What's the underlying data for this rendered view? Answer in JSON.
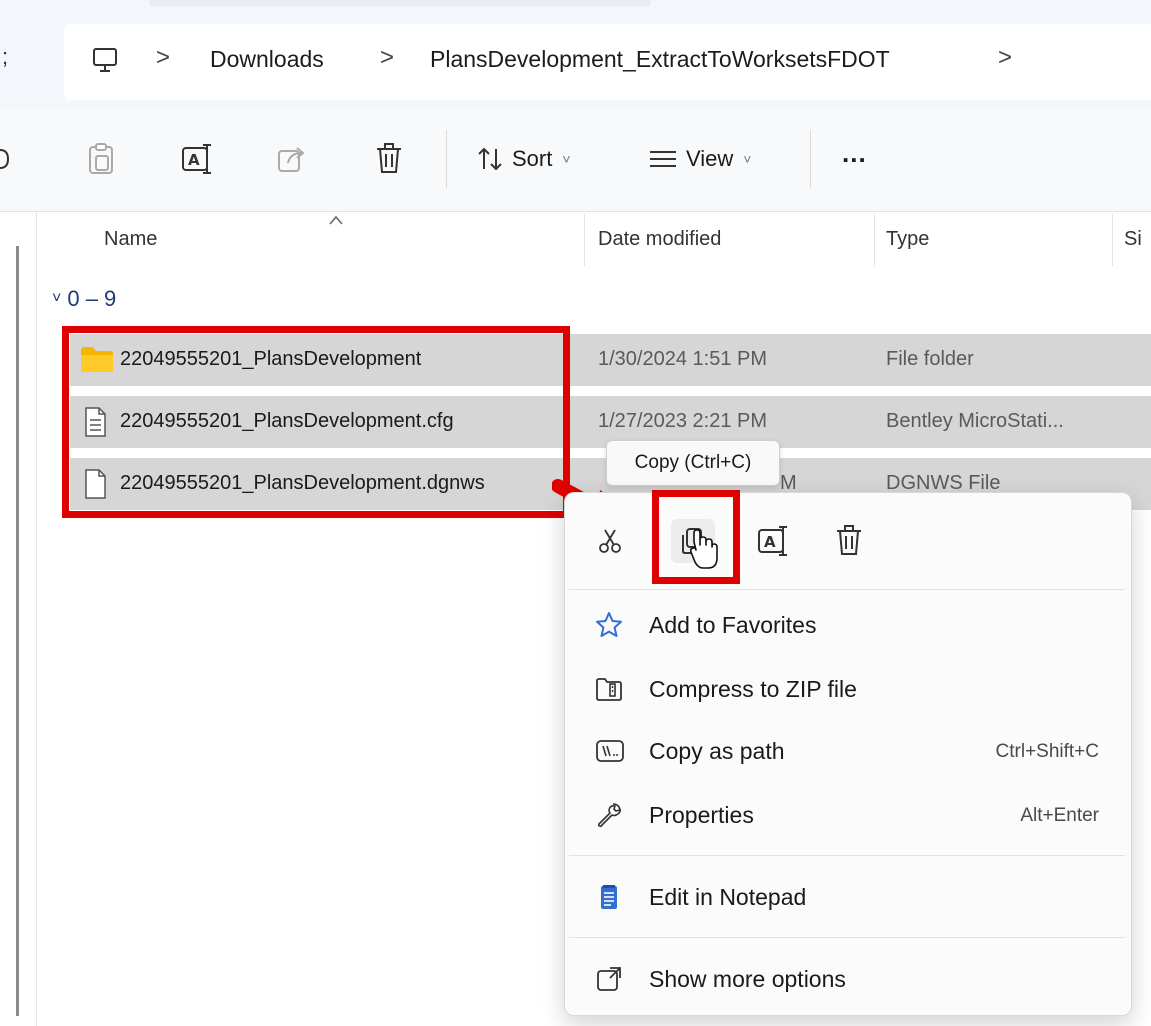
{
  "address_bar": {
    "left_glyph": ";",
    "crumbs": [
      "Downloads",
      "PlansDevelopment_ExtractToWorksetsFDOT"
    ],
    "separator": ">"
  },
  "toolbar": {
    "sort_label": "Sort",
    "view_label": "View",
    "more_label": "...",
    "chevron": "˅"
  },
  "columns": {
    "name": "Name",
    "date_modified": "Date modified",
    "type": "Type",
    "size": "Si"
  },
  "group": {
    "label": "0 – 9",
    "chevron": "˅"
  },
  "rows": [
    {
      "name": "22049555201_PlansDevelopment",
      "date": "1/30/2024 1:51 PM",
      "type": "File folder",
      "icon": "folder-icon"
    },
    {
      "name": "22049555201_PlansDevelopment.cfg",
      "date": "1/27/2023 2:21 PM",
      "type": "Bentley MicroStati...",
      "icon": "text-file-icon"
    },
    {
      "name": "22049555201_PlansDevelopment.dgnws",
      "date": "M",
      "type": "DGNWS File",
      "icon": "blank-file-icon"
    }
  ],
  "tooltip": {
    "text": "Copy (Ctrl+C)"
  },
  "context_menu": {
    "items": [
      {
        "label": "Add to Favorites",
        "accel": "",
        "icon": "star-icon"
      },
      {
        "label": "Compress to ZIP file",
        "accel": "",
        "icon": "zip-icon"
      },
      {
        "label": "Copy as path",
        "accel": "Ctrl+Shift+C",
        "icon": "path-icon"
      },
      {
        "label": "Properties",
        "accel": "Alt+Enter",
        "icon": "wrench-icon"
      },
      {
        "label": "Edit in Notepad",
        "accel": "",
        "icon": "notepad-icon"
      },
      {
        "label": "Show more options",
        "accel": "",
        "icon": "more-options-icon"
      }
    ]
  },
  "colors": {
    "highlight_red": "#e00000",
    "row_selected": "#d6d6d6",
    "group_blue": "#1f3a7a",
    "accent_blue": "#2f6fd6"
  }
}
